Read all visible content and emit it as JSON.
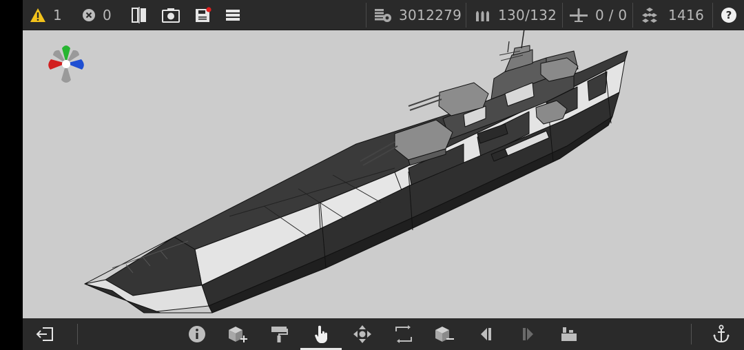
{
  "topbar": {
    "warnings": "1",
    "errors": "0",
    "displacement": "3012279",
    "ammo": "130/132",
    "aircraft": "0 / 0",
    "parts": "1416"
  },
  "icons": {
    "warning": "warning-triangle-icon",
    "error": "error-circle-icon",
    "mirror": "mirror-icon",
    "camera": "camera-icon",
    "save": "save-icon",
    "menu": "menu-icon",
    "displacement": "weight-icon",
    "ammo": "ammo-icon",
    "aircraft": "aircraft-icon",
    "parts": "parts-icon",
    "help": "help-icon",
    "exit": "exit-icon",
    "info": "info-icon",
    "add_block": "add-block-icon",
    "paint": "paint-roller-icon",
    "select": "hand-pointer-icon",
    "move": "move-icon",
    "rotate": "rotate-icon",
    "remove_block": "remove-block-icon",
    "prev": "step-back-icon",
    "next": "step-forward-icon",
    "weapons": "weapons-icon",
    "anchor": "anchor-icon"
  },
  "colors": {
    "bar": "#2a2a2a",
    "viewport": "#cccccc",
    "warning": "#f2c21b",
    "gizmo_x": "#d21f1f",
    "gizmo_y": "#27b531",
    "gizmo_z": "#1f4fd2",
    "hull_dark": "#2f2f2f",
    "hull_light": "#e4e4e4"
  },
  "toolbar": {
    "active_tool": "select"
  }
}
